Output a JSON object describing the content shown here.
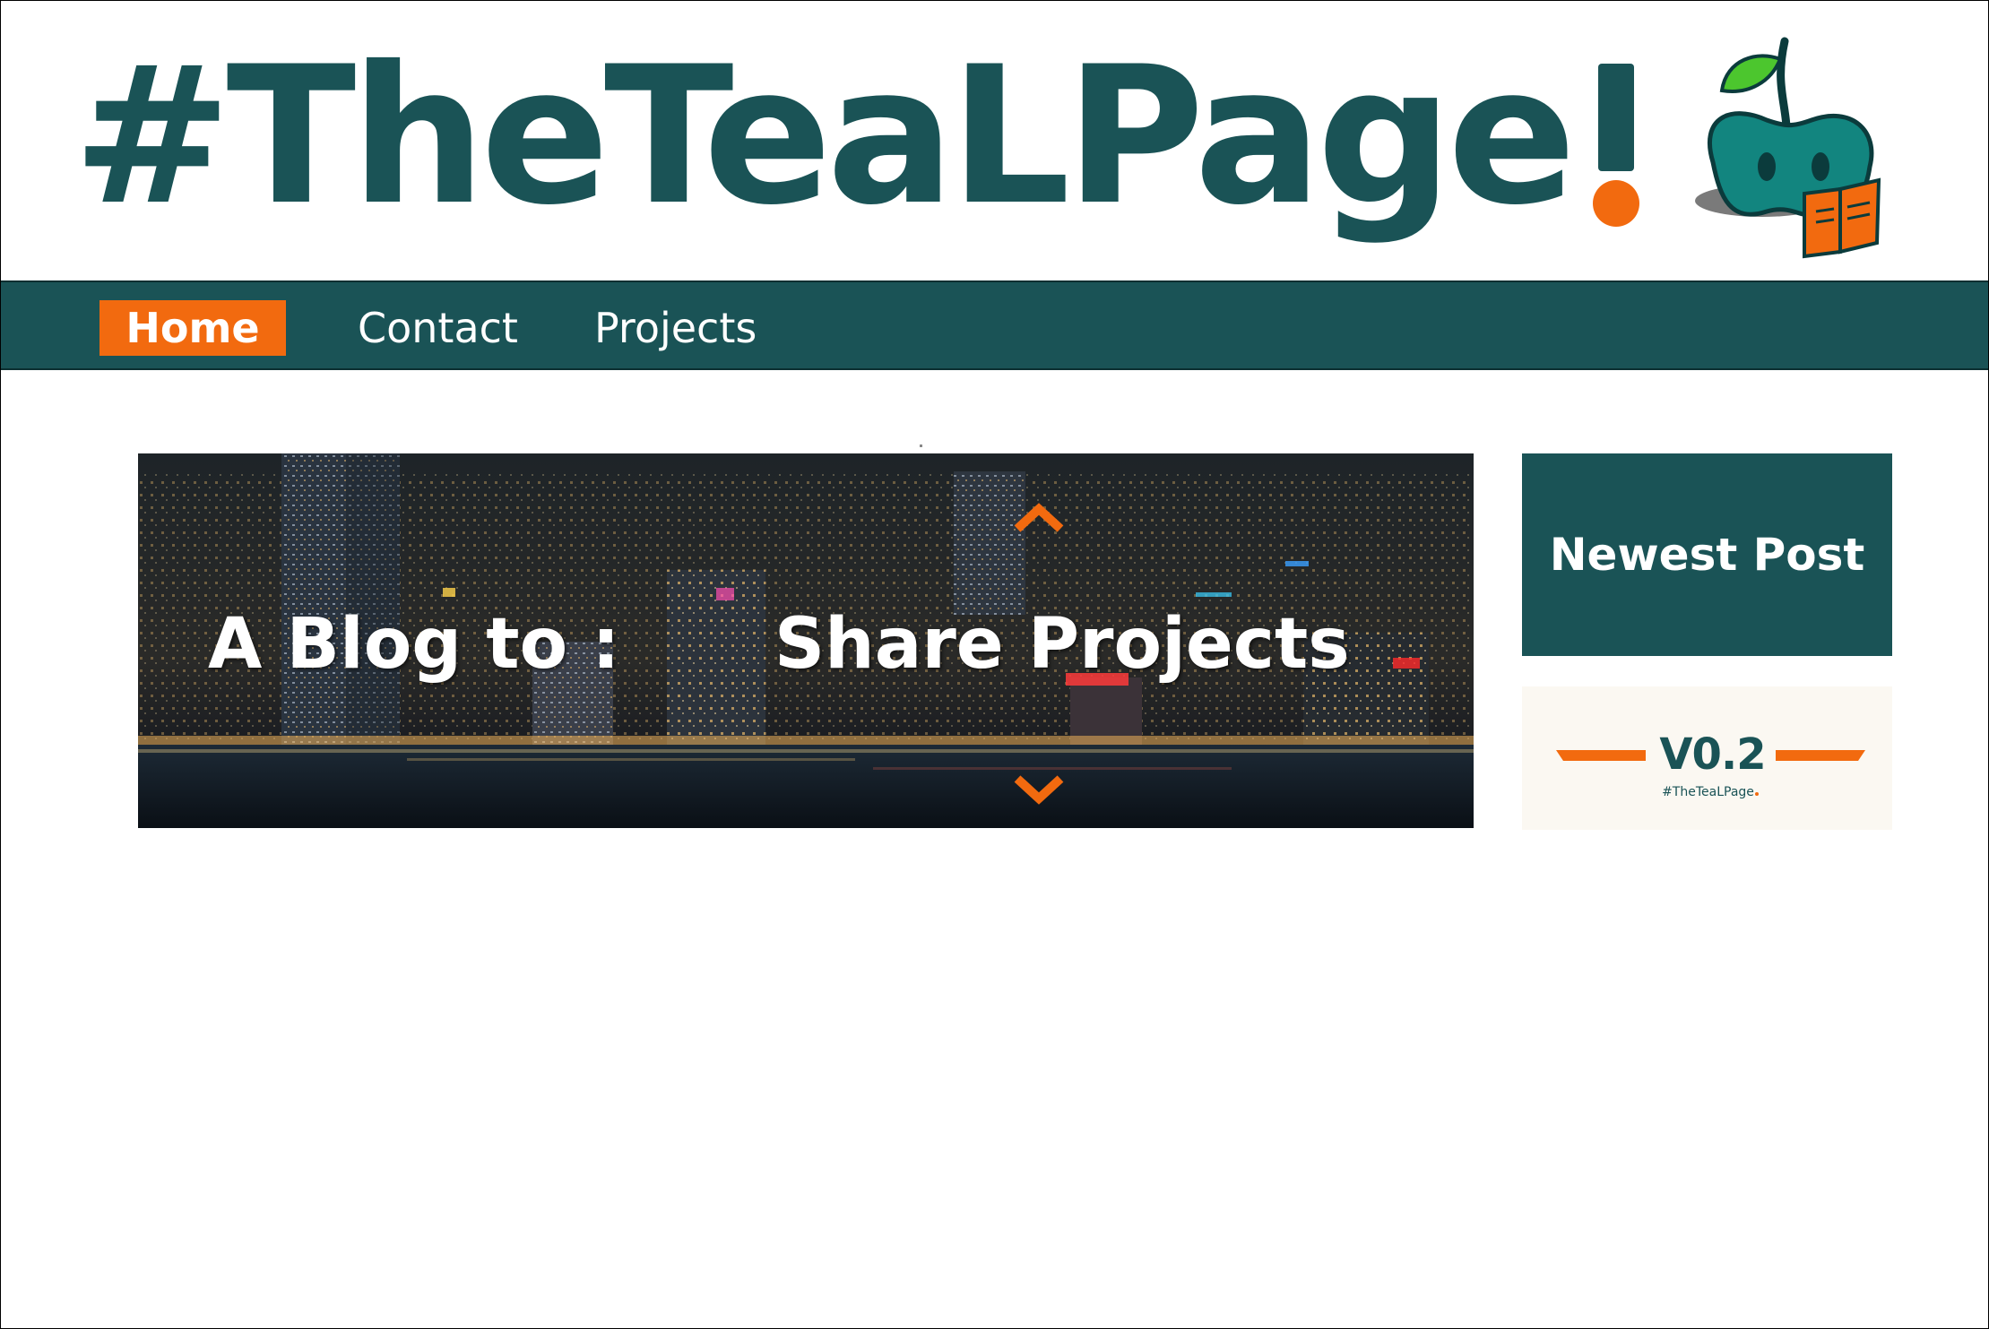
{
  "header": {
    "site_title": "#TheTeaLPage",
    "title_punctuation": "!",
    "mascot_icon": "apple-reading-book-icon"
  },
  "nav": {
    "items": [
      {
        "label": "Home",
        "active": true
      },
      {
        "label": "Contact",
        "active": false
      },
      {
        "label": "Projects",
        "active": false
      }
    ]
  },
  "banner": {
    "text_left": "A Blog to :",
    "text_right": "Share Projects",
    "up_icon": "chevron-up-icon",
    "down_icon": "chevron-down-icon"
  },
  "sidebar": {
    "newest_post_label": "Newest Post",
    "version_card": {
      "version": "V0.2",
      "tag": "#TheTeaLPage"
    }
  },
  "colors": {
    "teal": "#1a5356",
    "orange": "#f26a0f",
    "card_bg": "#fbf8f2"
  }
}
